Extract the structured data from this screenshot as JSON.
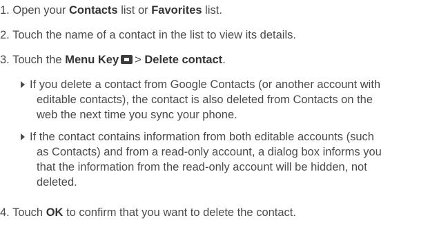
{
  "steps": {
    "s1": {
      "num": "1.",
      "a": "Open your",
      "b": "Contacts",
      "c": "list or",
      "d": "Favorites",
      "e": "list."
    },
    "s2": {
      "num": "2.",
      "text": "Touch the name of a contact in the list to view its details."
    },
    "s3": {
      "num": "3.",
      "a": "Touch the",
      "b": "Menu Key",
      "icon": "menu-key-icon",
      "c": ">",
      "d": "Delete contact",
      "e": "."
    },
    "s4": {
      "num": "4.",
      "a": "Touch",
      "b": "OK",
      "c": "to confirm that you want to delete the contact."
    }
  },
  "bullets": {
    "b1": {
      "l1": "If you delete a contact from Google Contacts (or another account with",
      "l2": "editable contacts), the contact is also deleted from Contacts on the",
      "l3": "web the next time you sync your phone."
    },
    "b2": {
      "l1": "If the contact contains information from both editable accounts (such",
      "l2": "as Contacts) and from a read-only account, a dialog box informs you",
      "l3": "that the information from the read-only account will be hidden, not",
      "l4": "deleted."
    }
  }
}
